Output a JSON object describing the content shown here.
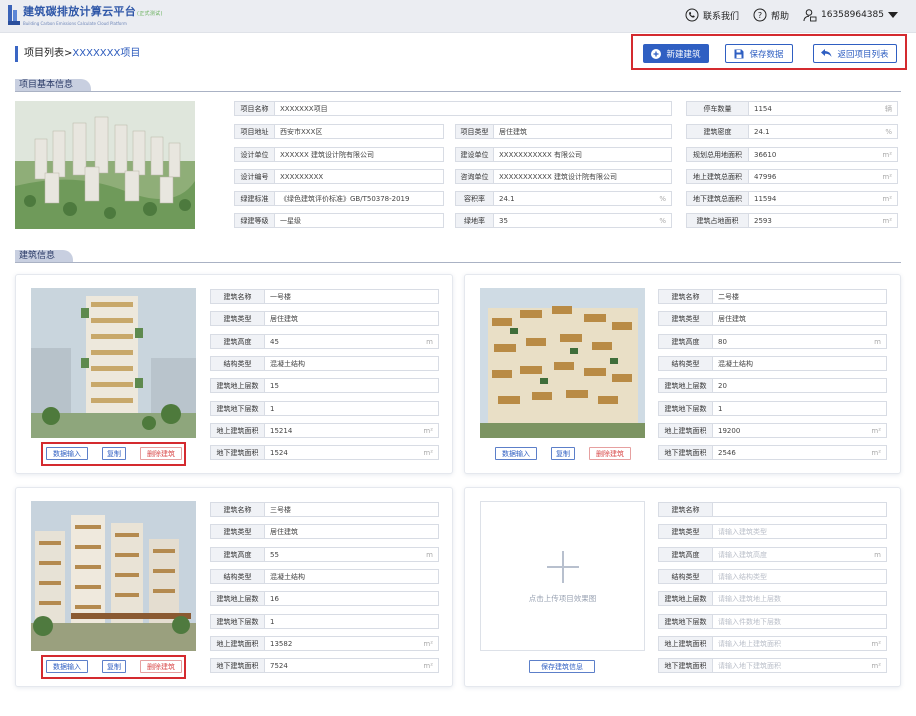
{
  "app": {
    "title": "建筑碳排放计算云平台",
    "title_badge": "(正式测试)",
    "subtitle": "Building Carbon Emissions Calculate Cloud Platform"
  },
  "header": {
    "contact": "联系我们",
    "help": "帮助",
    "user": "16358964385"
  },
  "breadcrumb": {
    "parent": "项目列表>",
    "current": "XXXXXXX项目"
  },
  "actions": {
    "new_building": "新建建筑",
    "save_data": "保存数据",
    "back_list": "返回项目列表"
  },
  "sections": {
    "project_info": "项目基本信息",
    "building_info": "建筑信息"
  },
  "project": {
    "name": {
      "label": "项目名称",
      "value": "XXXXXXX项目"
    },
    "address": {
      "label": "项目地址",
      "value": "西安市XXX区"
    },
    "type": {
      "label": "项目类型",
      "value": "居住建筑"
    },
    "design_unit": {
      "label": "设计单位",
      "value": "XXXXXX 建筑设计院有限公司"
    },
    "build_unit": {
      "label": "建设单位",
      "value": "XXXXXXXXXXX 有限公司"
    },
    "design_no": {
      "label": "设计编号",
      "value": "XXXXXXXXX"
    },
    "consult_unit": {
      "label": "咨询单位",
      "value": "XXXXXXXXXXX 建筑设计院有限公司"
    },
    "green_std": {
      "label": "绿建标准",
      "value": "《绿色建筑评价标准》GB/T50378-2019"
    },
    "far": {
      "label": "容积率",
      "value": "24.1",
      "unit": "%"
    },
    "green_grade": {
      "label": "绿建等级",
      "value": "一星级"
    },
    "green_rate": {
      "label": "绿地率",
      "value": "35",
      "unit": "%"
    },
    "parking": {
      "label": "停车数量",
      "value": "1154",
      "unit": "辆"
    },
    "density": {
      "label": "建筑密度",
      "value": "24.1",
      "unit": "%"
    },
    "land_area": {
      "label": "规划总用地面积",
      "value": "36610",
      "unit": "m²"
    },
    "above_area": {
      "label": "地上建筑总面积",
      "value": "47996",
      "unit": "m²"
    },
    "below_area": {
      "label": "地下建筑总面积",
      "value": "11594",
      "unit": "m²"
    },
    "footprint": {
      "label": "建筑占地面积",
      "value": "2593",
      "unit": "m²"
    }
  },
  "labels": {
    "name": "建筑名称",
    "type": "建筑类型",
    "height": "建筑高度",
    "structure": "结构类型",
    "floors_above": "建筑地上层数",
    "floors_below": "建筑地下层数",
    "area_above": "地上建筑面积",
    "area_below": "地下建筑面积",
    "unit_m": "m",
    "unit_m2": "m²"
  },
  "buildings": [
    {
      "name": "一号楼",
      "type": "居住建筑",
      "height": "45",
      "structure": "混凝土结构",
      "floors_above": "15",
      "floors_below": "1",
      "area_above": "15214",
      "area_below": "1524"
    },
    {
      "name": "二号楼",
      "type": "居住建筑",
      "height": "80",
      "structure": "混凝土结构",
      "floors_above": "20",
      "floors_below": "1",
      "area_above": "19200",
      "area_below": "2546"
    },
    {
      "name": "三号楼",
      "type": "居住建筑",
      "height": "55",
      "structure": "混凝土结构",
      "floors_above": "16",
      "floors_below": "1",
      "area_above": "13582",
      "area_below": "7524"
    }
  ],
  "card_buttons": {
    "input": "数据输入",
    "copy": "复制",
    "delete": "删除建筑"
  },
  "new_building": {
    "upload_text": "点击上传项目效果图",
    "save_button": "保存建筑信息",
    "placeholders": {
      "type": "请输入建筑类型",
      "height": "请输入建筑高度",
      "structure": "请输入结构类型",
      "floors_above": "请输入建筑地上层数",
      "floors_below": "请输入件数地下层数",
      "area_above": "请输入地上建筑面积",
      "area_below": "请输入地下建筑面积"
    }
  },
  "colors": {
    "primary": "#2f5fc2",
    "highlight_box": "#d42a2f"
  }
}
